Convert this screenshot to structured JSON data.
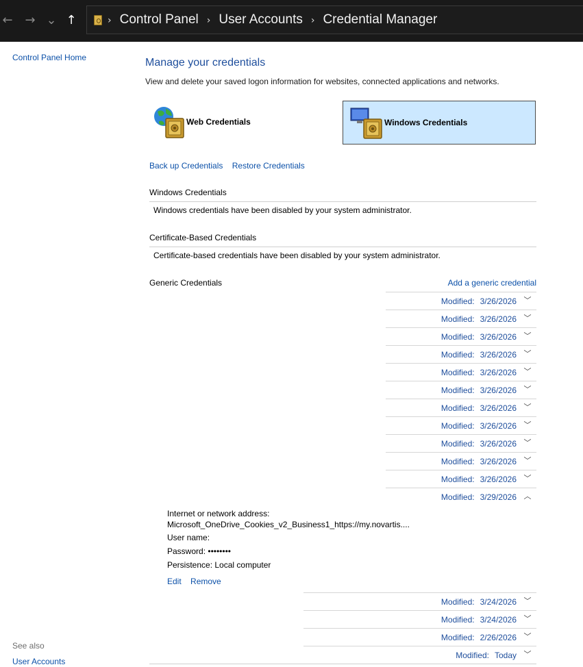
{
  "address_bar": {
    "nav": {
      "back": "←",
      "forward": "→",
      "recent": "⌄",
      "up": "↑"
    },
    "crumb_sep": "›",
    "breadcrumbs": [
      "Control Panel",
      "User Accounts",
      "Credential Manager"
    ]
  },
  "left_nav": {
    "home_link": "Control Panel Home",
    "see_also": "See also",
    "user_accounts": "User Accounts"
  },
  "main": {
    "title": "Manage your credentials",
    "subtitle": "View and delete your saved logon information for websites, connected applications and networks.",
    "tiles": {
      "web": "Web Credentials",
      "windows": "Windows Credentials"
    },
    "backup": "Back up Credentials",
    "restore": "Restore Credentials",
    "windows_section": {
      "title": "Windows Credentials",
      "message": "Windows credentials have been disabled by your system administrator."
    },
    "cert_section": {
      "title": "Certificate-Based Credentials",
      "message": "Certificate-based credentials have been disabled by your system administrator."
    },
    "generic_section": {
      "title": "Generic Credentials",
      "add_link": "Add a generic credential",
      "modified_label": "Modified:",
      "rows_before": [
        {
          "date": "3/26/2026"
        },
        {
          "date": "3/26/2026"
        },
        {
          "date": "3/26/2026"
        },
        {
          "date": "3/26/2026"
        },
        {
          "date": "3/26/2026"
        },
        {
          "date": "3/26/2026"
        },
        {
          "date": "3/26/2026"
        },
        {
          "date": "3/26/2026"
        },
        {
          "date": "3/26/2026"
        },
        {
          "date": "3/26/2026"
        },
        {
          "date": "3/26/2026"
        }
      ],
      "expanded_row": {
        "date": "3/29/2026",
        "address_label": "Internet or network address:",
        "address_value": "Microsoft_OneDrive_Cookies_v2_Business1_https://my.novartis....",
        "username_label": "User name:",
        "password_label": "Password:",
        "password_value": "••••••••",
        "persistence_label": "Persistence:",
        "persistence_value": "Local computer",
        "edit": "Edit",
        "remove": "Remove"
      },
      "rows_after": [
        {
          "date": "3/24/2026"
        },
        {
          "date": "3/24/2026"
        },
        {
          "date": "2/26/2026"
        },
        {
          "date": "Today"
        }
      ]
    }
  }
}
